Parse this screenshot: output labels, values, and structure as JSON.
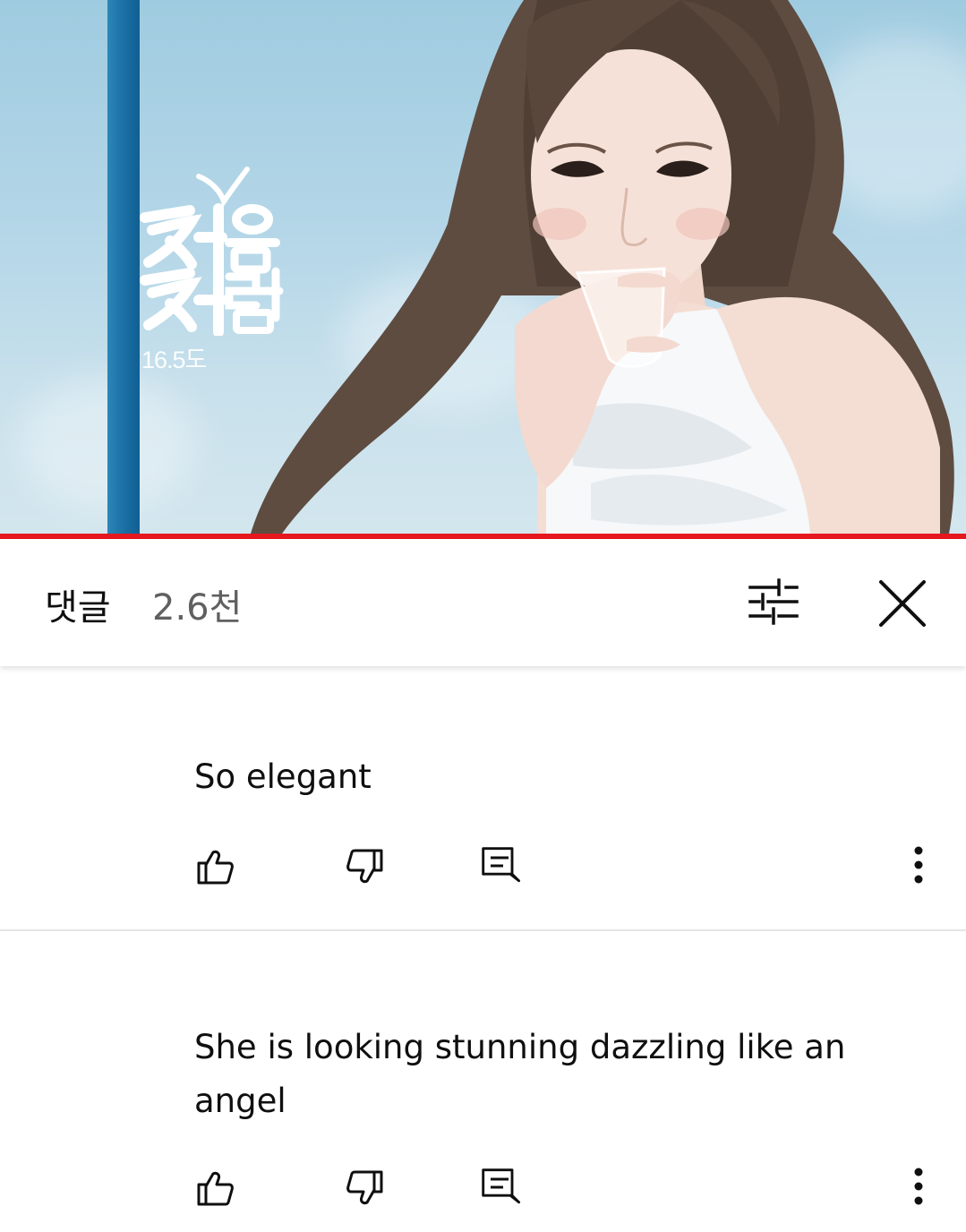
{
  "video": {
    "brand_logo_text": "처음처럼",
    "abv_label": "16.5도",
    "progress": 1.0,
    "progress_color": "#e5181e",
    "pole_color": "#1f74a8",
    "sky_color": "#b5d7e8"
  },
  "comments_panel": {
    "title": "댓글",
    "count": "2.6천",
    "filter_icon": "sort-filter-icon",
    "close_icon": "close-icon"
  },
  "comments": [
    {
      "text": "So elegant",
      "actions": [
        "like-icon",
        "dislike-icon",
        "reply-icon",
        "more-vert-icon"
      ]
    },
    {
      "text": "She is looking stunning dazzling like an angel",
      "actions": [
        "like-icon",
        "dislike-icon",
        "reply-icon",
        "more-vert-icon"
      ]
    }
  ]
}
